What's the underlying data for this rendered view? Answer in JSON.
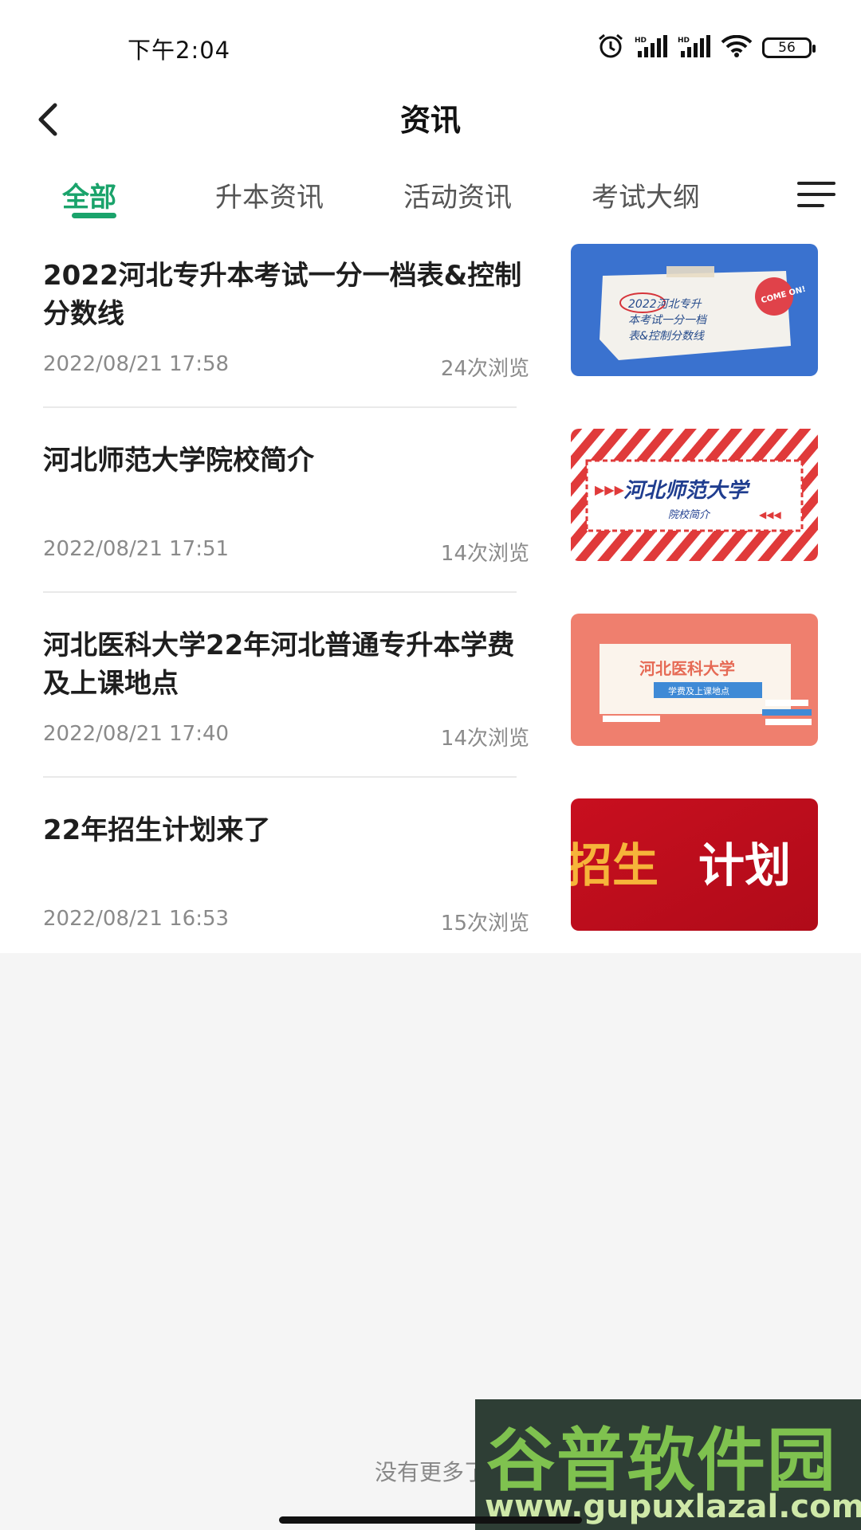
{
  "status_bar": {
    "time": "下午2:04",
    "battery": "56",
    "icons": [
      "alarm-icon",
      "signal-hd-icon",
      "signal-hd-icon",
      "wifi-icon",
      "battery-icon"
    ]
  },
  "header": {
    "title": "资讯",
    "back_icon": "chevron-left-icon"
  },
  "tabs": [
    {
      "label": "全部",
      "active": true
    },
    {
      "label": "升本资讯",
      "active": false
    },
    {
      "label": "活动资讯",
      "active": false
    },
    {
      "label": "考试大纲",
      "active": false
    }
  ],
  "menu_icon": "hamburger-menu-icon",
  "accent_color": "#1aa36b",
  "news": [
    {
      "title": "2022河北专升本考试一分一档表&控制分数线",
      "date": "2022/08/21 17:58",
      "views": "24次浏览",
      "thumb": {
        "lines": [
          "2022河北专升",
          "本考试一分一档",
          "表&控制分数线"
        ],
        "badge": "COME ON!"
      }
    },
    {
      "title": "河北师范大学院校简介",
      "date": "2022/08/21 17:51",
      "views": "14次浏览",
      "thumb": {
        "main": "河北师范大学",
        "sub": "院校简介"
      }
    },
    {
      "title": "河北医科大学22年河北普通专升本学费及上课地点",
      "date": "2022/08/21 17:40",
      "views": "14次浏览",
      "thumb": {
        "main": "河北医科大学",
        "sub": "学费及上课地点"
      }
    },
    {
      "title": "22年招生计划来了",
      "date": "2022/08/21 16:53",
      "views": "15次浏览",
      "thumb": {
        "part1": "招生",
        "part2": "计划"
      }
    }
  ],
  "footer": {
    "no_more": "没有更多了"
  },
  "watermark": {
    "title": "谷普软件园",
    "url": "www.gupuxlazal.com"
  }
}
